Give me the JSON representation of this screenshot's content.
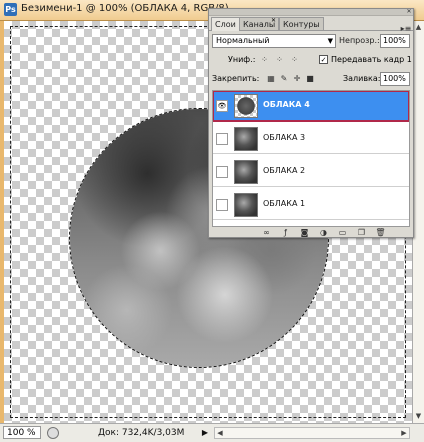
{
  "document": {
    "title": "Безимени-1 @ 100% (ОБЛАКА 4, RGB/8)",
    "app_icon": "photoshop-icon"
  },
  "status": {
    "zoom": "100 %",
    "doc_info": "Док: 732,4K/3,03M"
  },
  "layers_panel": {
    "tabs": [
      "Слои",
      "Каналы",
      "Контуры"
    ],
    "blend_mode": "Нормальный",
    "opacity_label": "Непрозр.:",
    "opacity_value": "100%",
    "unify_label": "Униф.:",
    "propagate_label": "Передавать кадр 1",
    "propagate_checked": true,
    "lock_label": "Закрепить:",
    "fill_label": "Заливка:",
    "fill_value": "100%",
    "layers": [
      {
        "name": "ОБЛАКА 4",
        "visible": true,
        "selected": true
      },
      {
        "name": "ОБЛАКА 3",
        "visible": false,
        "selected": false
      },
      {
        "name": "ОБЛАКА 2",
        "visible": false,
        "selected": false
      },
      {
        "name": "ОБЛАКА 1",
        "visible": false,
        "selected": false
      }
    ]
  },
  "colors": {
    "selected_layer": "#3d8ff0",
    "highlight_frame": "#b0284a",
    "window_frame": "#e9b86d"
  }
}
